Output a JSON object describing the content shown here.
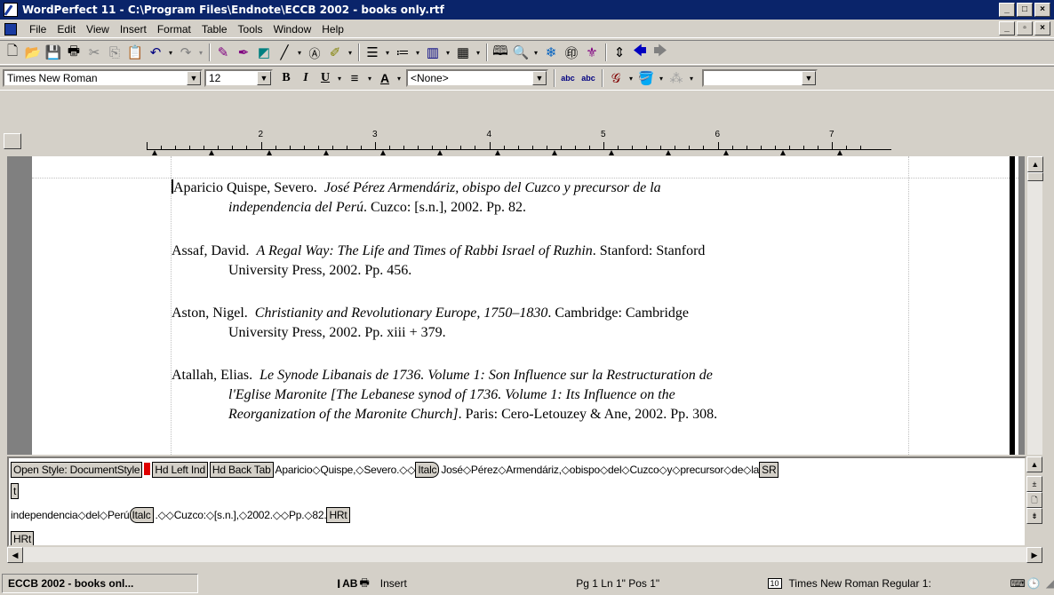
{
  "window": {
    "title": "WordPerfect 11 - C:\\Program Files\\Endnote\\ECCB 2002 - books only.rtf"
  },
  "menu": [
    "File",
    "Edit",
    "View",
    "Insert",
    "Format",
    "Table",
    "Tools",
    "Window",
    "Help"
  ],
  "propbar": {
    "font": "Times New Roman",
    "size": "12",
    "style": "<None>"
  },
  "ruler": {
    "numbers": [
      "2",
      "3",
      "4",
      "5",
      "6",
      "7"
    ]
  },
  "document": {
    "entries": [
      {
        "author": "Aparicio Quispe, Severo.",
        "title_line1": "José Pérez Armendáriz, obispo del Cuzco y precursor de la",
        "title_line2_italic": "independencia del Perú",
        "rest_line2": ".  Cuzco: [s.n.], 2002.  Pp. 82."
      },
      {
        "author": "Assaf, David.",
        "title_line1": "A Regal Way: The Life and Times of Rabbi Israel of Ruzhin",
        "rest_line1": ".  Stanford: Stanford",
        "line2": "University Press, 2002.  Pp. 456."
      },
      {
        "author": "Aston, Nigel.",
        "title_line1": "Christianity and Revolutionary Europe, 1750–1830",
        "rest_line1": ".  Cambridge: Cambridge",
        "line2": "University Press, 2002.  Pp. xiii + 379."
      },
      {
        "author": "Atallah, Elias.",
        "title_line1": "Le Synode Libanais de 1736.  Volume 1: Son Influence sur la Restructuration de",
        "title_line2": "l'Eglise Maronite [The Lebanese synod of 1736.  Volume 1: Its Influence on the",
        "title_line3": "Reorganization of the Maronite Church]",
        "rest_line3": ".  Paris: Cero-Letouzey & Ane, 2002.  Pp. 308."
      }
    ]
  },
  "reveal_codes": {
    "open_style": "Open Style: DocumentStyle",
    "hd_left_ind": "Hd Left Ind",
    "hd_back_tab": "Hd Back Tab",
    "text1": "Aparicio◇Quispe,◇Severo.◇◇",
    "italc": "Italc",
    "text2": "José◇Pérez◇Armendáriz,◇obispo◇del◇Cuzco◇y◇precursor◇de◇la",
    "sr": "SR",
    "sr_wrap": "t",
    "text3": "independencia◇del◇Perú",
    "italc_end": "Italc",
    "text4": ".◇◇Cuzco:◇[s.n.],◇2002.◇◇Pp.◇82.",
    "hrt": "HRt",
    "hrt2": "HRt"
  },
  "status": {
    "doc": "ECCB 2002 - books onl...",
    "ab": "AB",
    "mode": "Insert",
    "position": "Pg 1 Ln 1\" Pos 1\"",
    "font_badge": "10",
    "font": "Times New Roman Regular 1:"
  }
}
